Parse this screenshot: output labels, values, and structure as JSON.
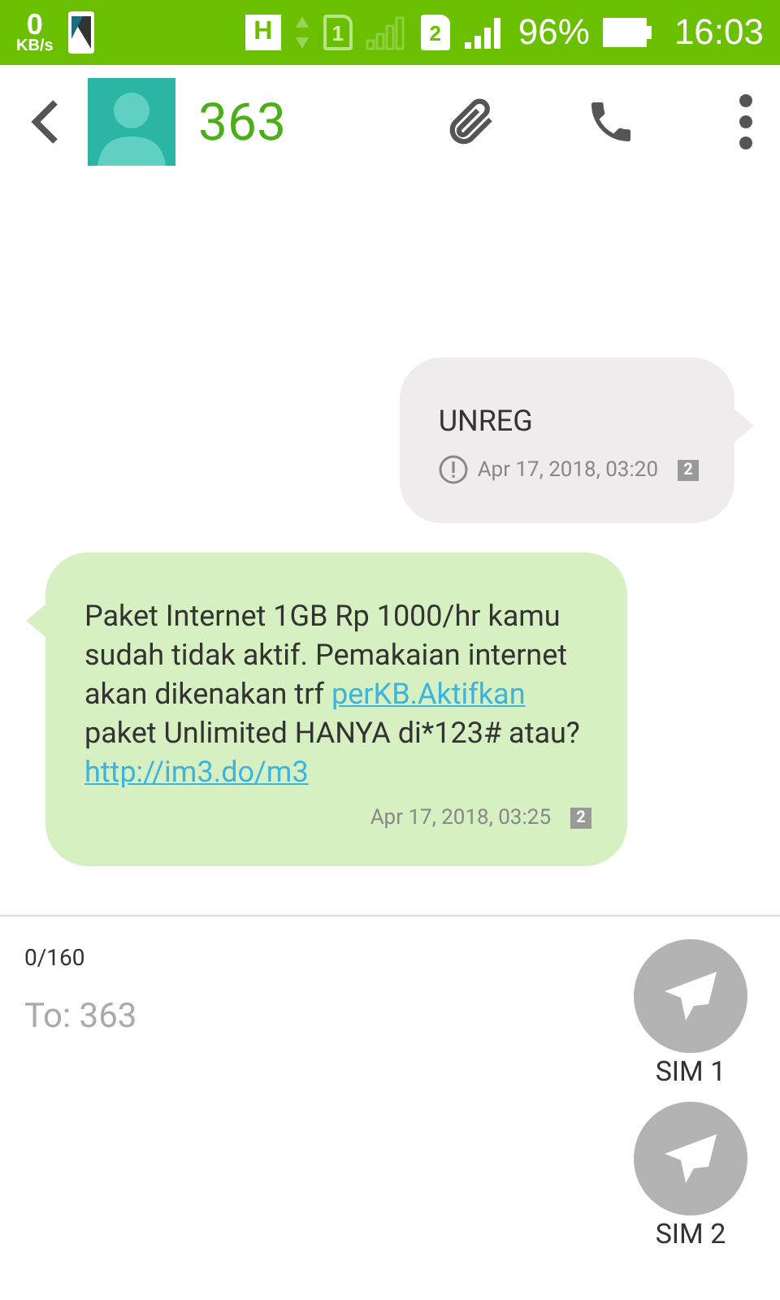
{
  "status_bar": {
    "speed": "0",
    "speed_unit": "KB/s",
    "network_type": "H",
    "sim1": "1",
    "sim2": "2",
    "battery": "96%",
    "time": "16:03"
  },
  "header": {
    "title": "363"
  },
  "messages": [
    {
      "kind": "sent",
      "failed": true,
      "parts": [
        {
          "kind": "text",
          "text": "UNREG"
        }
      ],
      "time": "Apr 17, 2018, 03:20",
      "sim": "2"
    },
    {
      "kind": "received",
      "failed": false,
      "parts": [
        {
          "kind": "text",
          "text": "Paket Internet 1GB Rp 1000/hr kamu sudah tidak aktif. Pemakaian internet akan dikenakan trf "
        },
        {
          "kind": "link",
          "text": "perKB.Aktifkan"
        },
        {
          "kind": "text",
          "text": " paket Unlimited HANYA di*123# atau?"
        },
        {
          "kind": "link",
          "text": "http://im3.do/m3"
        }
      ],
      "time": "Apr 17, 2018, 03:25",
      "sim": "2"
    }
  ],
  "composer": {
    "counter": "0/160",
    "placeholder": "To: 363",
    "send_buttons": [
      {
        "label": "SIM 1"
      },
      {
        "label": "SIM 2"
      }
    ]
  }
}
